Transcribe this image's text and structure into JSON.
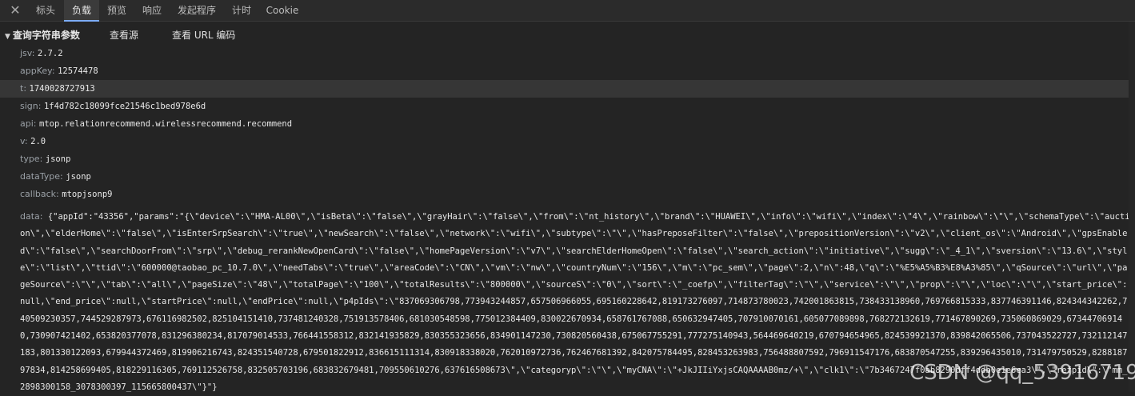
{
  "tabs": {
    "close": "✕",
    "items": [
      "标头",
      "负载",
      "预览",
      "响应",
      "发起程序",
      "计时",
      "Cookie"
    ],
    "active": "负载"
  },
  "section": {
    "title": "查询字符串参数",
    "view_source": "查看源",
    "view_url_encoded": "查看 URL 编码"
  },
  "params": [
    {
      "key": "jsv:",
      "value": "2.7.2"
    },
    {
      "key": "appKey:",
      "value": "12574478"
    },
    {
      "key": "t:",
      "value": "1740028727913"
    },
    {
      "key": "sign:",
      "value": "1f4d782c18099fce21546c1bed978e6d"
    },
    {
      "key": "api:",
      "value": "mtop.relationrecommend.wirelessrecommend.recommend"
    },
    {
      "key": "v:",
      "value": "2.0"
    },
    {
      "key": "type:",
      "value": "jsonp"
    },
    {
      "key": "dataType:",
      "value": "jsonp"
    },
    {
      "key": "callback:",
      "value": "mtopjsonp9"
    }
  ],
  "data_param": {
    "key": "data:",
    "value": "{\"appId\":\"43356\",\"params\":\"{\\\"device\\\":\\\"HMA-AL00\\\",\\\"isBeta\\\":\\\"false\\\",\\\"grayHair\\\":\\\"false\\\",\\\"from\\\":\\\"nt_history\\\",\\\"brand\\\":\\\"HUAWEI\\\",\\\"info\\\":\\\"wifi\\\",\\\"index\\\":\\\"4\\\",\\\"rainbow\\\":\\\"\\\",\\\"schemaType\\\":\\\"auction\\\",\\\"elderHome\\\":\\\"false\\\",\\\"isEnterSrpSearch\\\":\\\"true\\\",\\\"newSearch\\\":\\\"false\\\",\\\"network\\\":\\\"wifi\\\",\\\"subtype\\\":\\\"\\\",\\\"hasPreposeFilter\\\":\\\"false\\\",\\\"prepositionVersion\\\":\\\"v2\\\",\\\"client_os\\\":\\\"Android\\\",\\\"gpsEnabled\\\":\\\"false\\\",\\\"searchDoorFrom\\\":\\\"srp\\\",\\\"debug_rerankNewOpenCard\\\":\\\"false\\\",\\\"homePageVersion\\\":\\\"v7\\\",\\\"searchElderHomeOpen\\\":\\\"false\\\",\\\"search_action\\\":\\\"initiative\\\",\\\"sugg\\\":\\\"_4_1\\\",\\\"sversion\\\":\\\"13.6\\\",\\\"style\\\":\\\"list\\\",\\\"ttid\\\":\\\"600000@taobao_pc_10.7.0\\\",\\\"needTabs\\\":\\\"true\\\",\\\"areaCode\\\":\\\"CN\\\",\\\"vm\\\":\\\"nw\\\",\\\"countryNum\\\":\\\"156\\\",\\\"m\\\":\\\"pc_sem\\\",\\\"page\\\":2,\\\"n\\\":48,\\\"q\\\":\\\"%E5%A5%B3%E8%A3%85\\\",\\\"qSource\\\":\\\"url\\\",\\\"pageSource\\\":\\\"\\\",\\\"tab\\\":\\\"all\\\",\\\"pageSize\\\":\\\"48\\\",\\\"totalPage\\\":\\\"100\\\",\\\"totalResults\\\":\\\"800000\\\",\\\"sourceS\\\":\\\"0\\\",\\\"sort\\\":\\\"_coefp\\\",\\\"filterTag\\\":\\\"\\\",\\\"service\\\":\\\"\\\",\\\"prop\\\":\\\"\\\",\\\"loc\\\":\\\"\\\",\\\"start_price\\\":null,\\\"end_price\\\":null,\\\"startPrice\\\":null,\\\"endPrice\\\":null,\\\"p4pIds\\\":\\\"837069306798,773943244857,657506966055,695160228642,819173276097,714873780023,742001863815,738433138960,769766815333,837746391146,824344342262,740509230357,744529287973,676116982502,825104151410,737481240328,751913578406,681030548598,775012384409,830022670934,658761767088,650632947405,707910070161,605077089898,768272132619,771467890269,735060869029,673447069140,730907421402,653820377078,831296380234,817079014533,766441558312,832141935829,830355323656,834901147230,730820560438,675067755291,777275140943,564469640219,670794654965,824539921370,839842065506,737043522727,732112147183,801330122093,679944372469,819906216743,824351540728,679501822912,836615111314,830918338020,762010972736,762467681392,842075784495,828453263983,756488807592,796911547176,683870547255,839296435010,731479750529,828818797834,814258699405,818229116305,769112526758,832505703196,683832679481,709550610276,637616508673\\\",\\\"categoryp\\\":\\\"\\\",\\\"myCNA\\\":\\\"+JkJIIiYxjsCAQAAAAB0mz/+\\\",\\\"clk1\\\":\\\"7b3467247f0ab8290dff4ddb0e1e6ea3\\\",\\\"refpid\\\":\\\"mm_2898300158_3078300397_115665800437\\\"}\"}"
  },
  "watermark": "CSDN @qq_53916719",
  "colors": {
    "background": "#242424",
    "tab_accent": "#7cacf8",
    "key_text": "#9aa0a6",
    "value_text": "#e8e8e8"
  }
}
